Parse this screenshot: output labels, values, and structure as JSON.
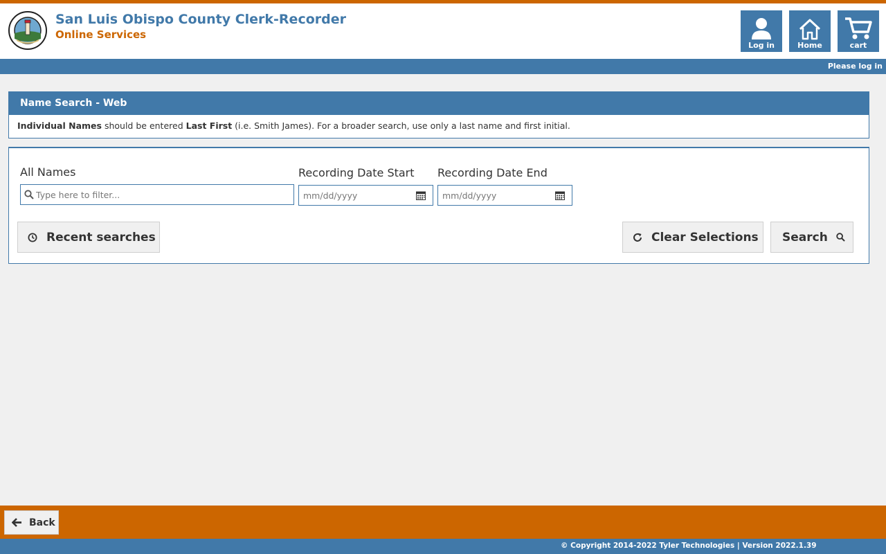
{
  "header": {
    "title": "San Luis Obispo County Clerk-Recorder",
    "subtitle": "Online Services",
    "nav": {
      "login_label": "Log in",
      "home_label": "Home",
      "cart_label": "cart"
    },
    "login_status": "Please log in"
  },
  "panel": {
    "title": "Name Search - Web",
    "info": {
      "bold1": "Individual Names",
      "text1": " should be entered ",
      "bold2": "Last First",
      "text2": " (i.e. Smith James). For a broader search, use only a last name and first initial."
    }
  },
  "form": {
    "all_names_label": "All Names",
    "all_names_placeholder": "Type here to filter...",
    "date_start_label": "Recording Date Start",
    "date_start_placeholder": "mm/dd/yyyy",
    "date_end_label": "Recording Date End",
    "date_end_placeholder": "mm/dd/yyyy",
    "recent_label": "Recent searches",
    "clear_label": "Clear Selections",
    "search_label": "Search"
  },
  "footer": {
    "back_label": "Back",
    "copyright": "© Copyright 2014-2022 Tyler Technologies | Version 2022.1.39"
  },
  "colors": {
    "primary_blue": "#4179a9",
    "accent_orange": "#cc6600",
    "background": "#f0f0f0"
  },
  "icons": {
    "seal": "county-seal-logo",
    "login": "user-icon",
    "home": "home-icon",
    "cart": "cart-icon",
    "search": "magnifier-icon",
    "calendar": "calendar-icon",
    "history": "clock-history-icon",
    "refresh": "refresh-icon",
    "back": "arrow-left-icon"
  }
}
